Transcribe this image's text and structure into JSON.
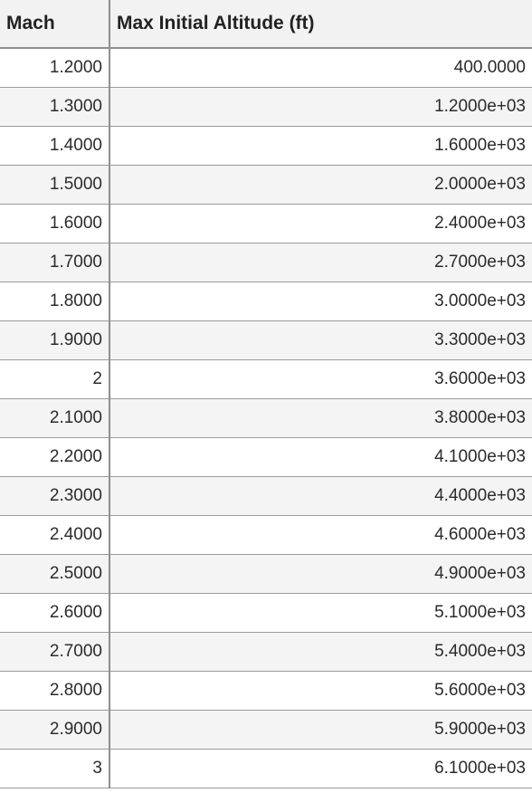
{
  "table": {
    "headers": {
      "mach": "Mach",
      "altitude": "Max Initial Altitude (ft)"
    },
    "rows": [
      {
        "mach": "1.2000",
        "altitude": "400.0000"
      },
      {
        "mach": "1.3000",
        "altitude": "1.2000e+03"
      },
      {
        "mach": "1.4000",
        "altitude": "1.6000e+03"
      },
      {
        "mach": "1.5000",
        "altitude": "2.0000e+03"
      },
      {
        "mach": "1.6000",
        "altitude": "2.4000e+03"
      },
      {
        "mach": "1.7000",
        "altitude": "2.7000e+03"
      },
      {
        "mach": "1.8000",
        "altitude": "3.0000e+03"
      },
      {
        "mach": "1.9000",
        "altitude": "3.3000e+03"
      },
      {
        "mach": "2",
        "altitude": "3.6000e+03"
      },
      {
        "mach": "2.1000",
        "altitude": "3.8000e+03"
      },
      {
        "mach": "2.2000",
        "altitude": "4.1000e+03"
      },
      {
        "mach": "2.3000",
        "altitude": "4.4000e+03"
      },
      {
        "mach": "2.4000",
        "altitude": "4.6000e+03"
      },
      {
        "mach": "2.5000",
        "altitude": "4.9000e+03"
      },
      {
        "mach": "2.6000",
        "altitude": "5.1000e+03"
      },
      {
        "mach": "2.7000",
        "altitude": "5.4000e+03"
      },
      {
        "mach": "2.8000",
        "altitude": "5.6000e+03"
      },
      {
        "mach": "2.9000",
        "altitude": "5.9000e+03"
      },
      {
        "mach": "3",
        "altitude": "6.1000e+03"
      }
    ]
  }
}
